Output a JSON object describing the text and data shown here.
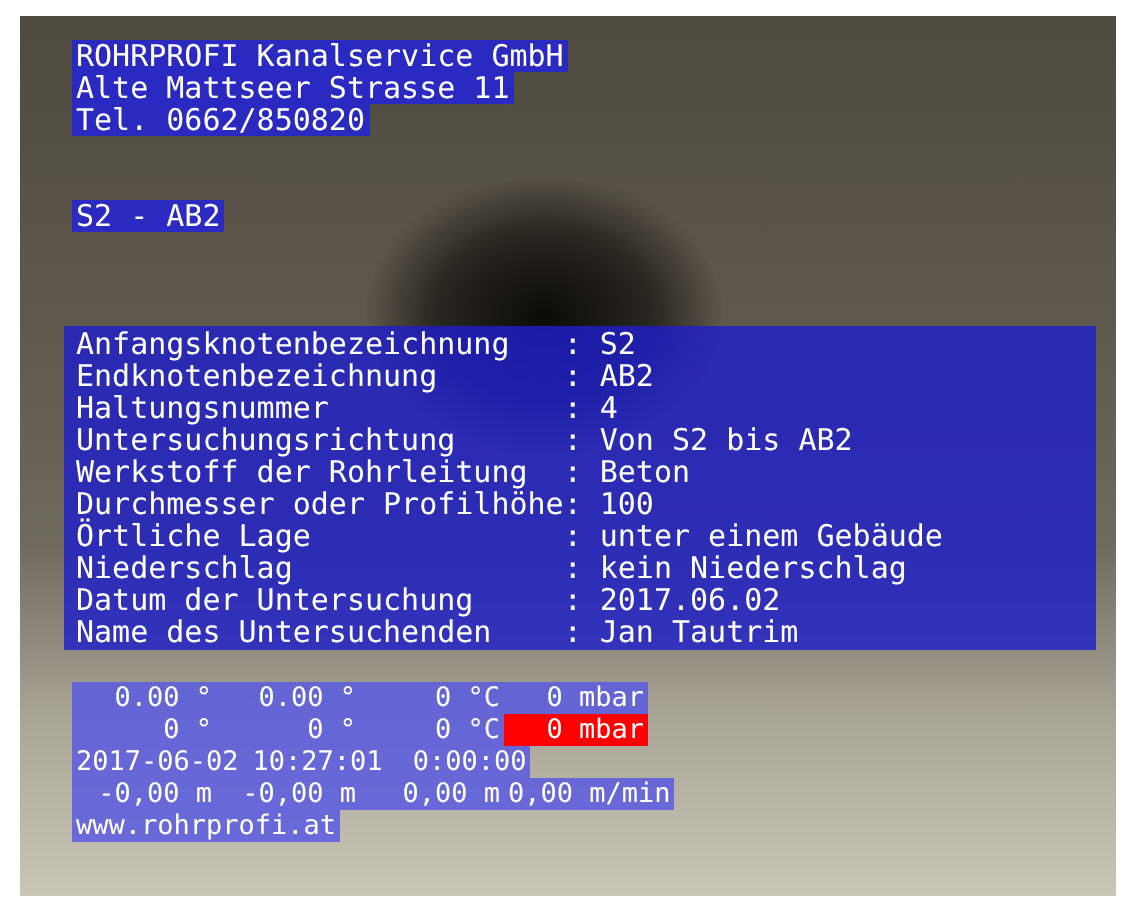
{
  "header": [
    "ROHRPROFI Kanalservice GmbH",
    "Alte Mattseer Strasse 11",
    "Tel. 0662/850820"
  ],
  "section": "S2 - AB2",
  "fields": [
    {
      "label": "Anfangsknotenbezeichnung",
      "separator": ":",
      "value": "S2"
    },
    {
      "label": "Endknotenbezeichnung",
      "separator": ":",
      "value": "AB2"
    },
    {
      "label": "Haltungsnummer",
      "separator": ":",
      "value": "4"
    },
    {
      "label": "Untersuchungsrichtung",
      "separator": ":",
      "value": "Von S2 bis AB2"
    },
    {
      "label": "Werkstoff der Rohrleitung",
      "separator": ":",
      "value": "Beton"
    },
    {
      "label": "Durchmesser oder Profilhöhe",
      "separator": ":",
      "value": "100"
    },
    {
      "label": "Örtliche Lage",
      "separator": ":",
      "value": "unter einem Gebäude"
    },
    {
      "label": "Niederschlag",
      "separator": ":",
      "value": "kein Niederschlag"
    },
    {
      "label": "Datum der Untersuchung",
      "separator": ":",
      "value": "2017.06.02"
    },
    {
      "label": "Name des Untersuchenden",
      "separator": ":",
      "value": "Jan Tautrim"
    }
  ],
  "readings": [
    [
      {
        "text": "0.00 °",
        "alarm": false
      },
      {
        "text": "0.00 °",
        "alarm": false
      },
      {
        "text": "0 °C",
        "alarm": false
      },
      {
        "text": "0 mbar",
        "alarm": false
      }
    ],
    [
      {
        "text": "0 °",
        "alarm": false
      },
      {
        "text": "0 °",
        "alarm": false
      },
      {
        "text": "0 °C",
        "alarm": false
      },
      {
        "text": "0 mbar",
        "alarm": true
      }
    ],
    [
      {
        "text": "2017-06-02",
        "alarm": false
      },
      {
        "text": "10:27:01",
        "alarm": false
      },
      {
        "text": "0:00:00",
        "alarm": false
      }
    ],
    [
      {
        "text": "-0,00 m",
        "alarm": false
      },
      {
        "text": "-0,00 m",
        "alarm": false
      },
      {
        "text": "0,00 m",
        "alarm": false
      },
      {
        "text": "0,00 m/min",
        "alarm": false
      }
    ]
  ],
  "website": "www.rohrprofi.at"
}
